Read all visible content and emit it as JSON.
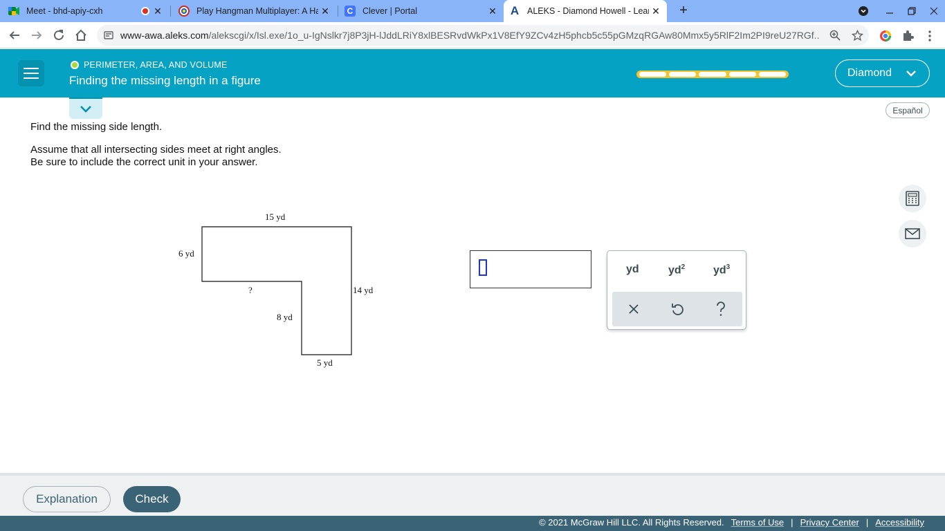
{
  "browser": {
    "tabs": [
      {
        "title": "Meet - bhd-apiy-cxh",
        "icon": "google-meet-icon"
      },
      {
        "title": "Play Hangman Multiplayer: A Ha",
        "icon": "hangman-icon"
      },
      {
        "title": "Clever | Portal",
        "icon": "clever-icon"
      },
      {
        "title": "ALEKS - Diamond Howell - Learn",
        "icon": "aleks-icon"
      }
    ],
    "url_host": "www-awa.aleks.com",
    "url_path": "/alekscgi/x/Isl.exe/1o_u-IgNslkr7j8P3jH-lJddLRiY8xlBESRvdWkPx1V8EfY9ZCv4zH5phcb5c55pGMzqRGAw80Mmx5y5RlF2Im2PI9reU27RGf..."
  },
  "header": {
    "topic": "PERIMETER, AREA, AND VOLUME",
    "title": "Finding the missing length in a figure",
    "progress_segments": 5,
    "user": "Diamond"
  },
  "espanol": "Español",
  "problem": {
    "line1": "Find the missing side length.",
    "line2": "Assume that all intersecting sides meet at right angles.",
    "line3": "Be sure to include the correct unit in your answer."
  },
  "figure": {
    "top": "15 yd",
    "left": "6 yd",
    "unknown": "?",
    "right": "14 yd",
    "inner": "8 yd",
    "bottom": "5 yd"
  },
  "keypad": {
    "unit1": "yd",
    "unit2": "yd",
    "unit3": "yd",
    "sup2": "2",
    "sup3": "3"
  },
  "footer": {
    "explanation": "Explanation",
    "check": "Check",
    "copyright": "© 2021 McGraw Hill LLC. All Rights Reserved.",
    "terms": "Terms of Use",
    "privacy": "Privacy Center",
    "accessibility": "Accessibility",
    "sep": "|"
  }
}
